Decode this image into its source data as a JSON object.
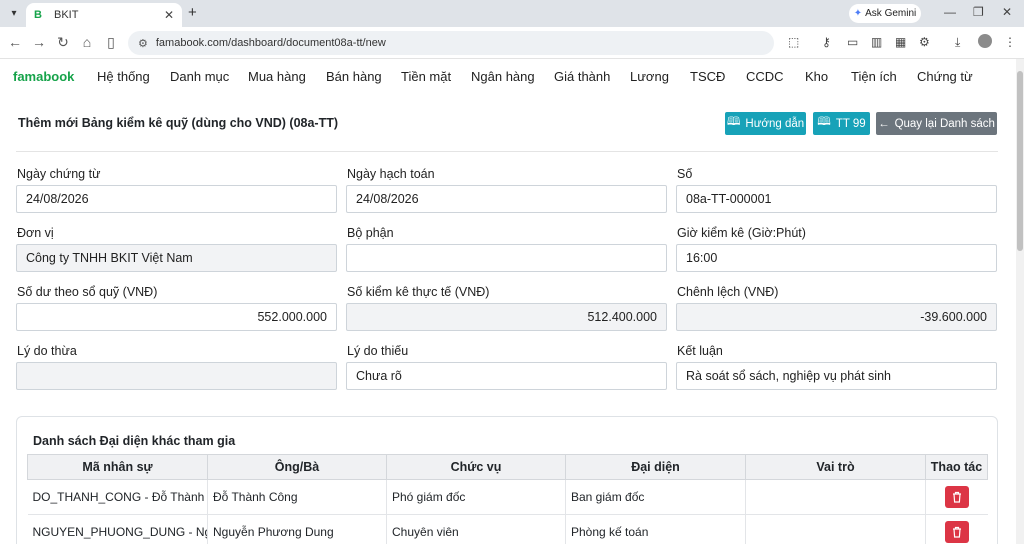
{
  "browser": {
    "tab_title": "BKIT",
    "tab_favicon": "B",
    "url": "famabook.com/dashboard/document08a-tt/new",
    "gemini_label": "Ask Gemini"
  },
  "app": {
    "brand": "famabook",
    "menu": [
      "Hệ thống",
      "Danh mục",
      "Mua hàng",
      "Bán hàng",
      "Tiền mặt",
      "Ngân hàng",
      "Giá thành",
      "Lương",
      "TSCĐ",
      "CCDC",
      "Kho",
      "Tiện ích",
      "Chứng từ"
    ]
  },
  "page": {
    "title": "Thêm mới Bảng kiểm kê quỹ (dùng cho VND) (08a-TT)",
    "btn_guide": "Hướng dẫn",
    "btn_tt99": "TT 99",
    "btn_back": "Quay lại Danh sách"
  },
  "form": {
    "ngay_chung_tu": {
      "label": "Ngày chứng từ",
      "value": "24/08/2026"
    },
    "ngay_hach_toan": {
      "label": "Ngày hạch toán",
      "value": "24/08/2026"
    },
    "so": {
      "label": "Số",
      "value": "08a-TT-000001"
    },
    "don_vi": {
      "label": "Đơn vị",
      "value": "Công ty TNHH BKIT Việt Nam"
    },
    "bo_phan": {
      "label": "Bộ phận",
      "value": ""
    },
    "gio_kiem_ke": {
      "label": "Giờ kiểm kê (Giờ:Phút)",
      "value": "16:00"
    },
    "so_du_so_quy": {
      "label": "Số dư theo sổ quỹ (VNĐ)",
      "value": "552.000.000"
    },
    "so_kiem_ke": {
      "label": "Số kiểm kê thực tế (VNĐ)",
      "value": "512.400.000"
    },
    "chenh_lech": {
      "label": "Chênh lệch (VNĐ)",
      "value": "-39.600.000"
    },
    "ly_do_thua": {
      "label": "Lý do thừa",
      "value": ""
    },
    "ly_do_thieu": {
      "label": "Lý do thiếu",
      "value": "Chưa rõ"
    },
    "ket_luan": {
      "label": "Kết luận",
      "value": "Rà soát sổ sách, nghiệp vụ phát sinh"
    }
  },
  "participants": {
    "title": "Danh sách Đại diện khác tham gia",
    "columns": [
      "Mã nhân sự",
      "Ông/Bà",
      "Chức vụ",
      "Đại diện",
      "Vai trò",
      "Thao tác"
    ],
    "rows": [
      {
        "ma": "DO_THANH_CONG - Đỗ Thành Công",
        "ten": "Đỗ Thành Công",
        "chuc_vu": "Phó giám đốc",
        "dai_dien": "Ban giám đốc",
        "vai_tro": ""
      },
      {
        "ma": "NGUYEN_PHUONG_DUNG - Nguyễn Phương Dung",
        "ten": "Nguyễn Phương Dung",
        "chuc_vu": "Chuyên viên",
        "dai_dien": "Phòng kế toán",
        "vai_tro": ""
      }
    ]
  },
  "colors": {
    "brand": "#16a34a",
    "info": "#17a2b8",
    "secondary": "#6c757d",
    "danger": "#dc3545"
  }
}
